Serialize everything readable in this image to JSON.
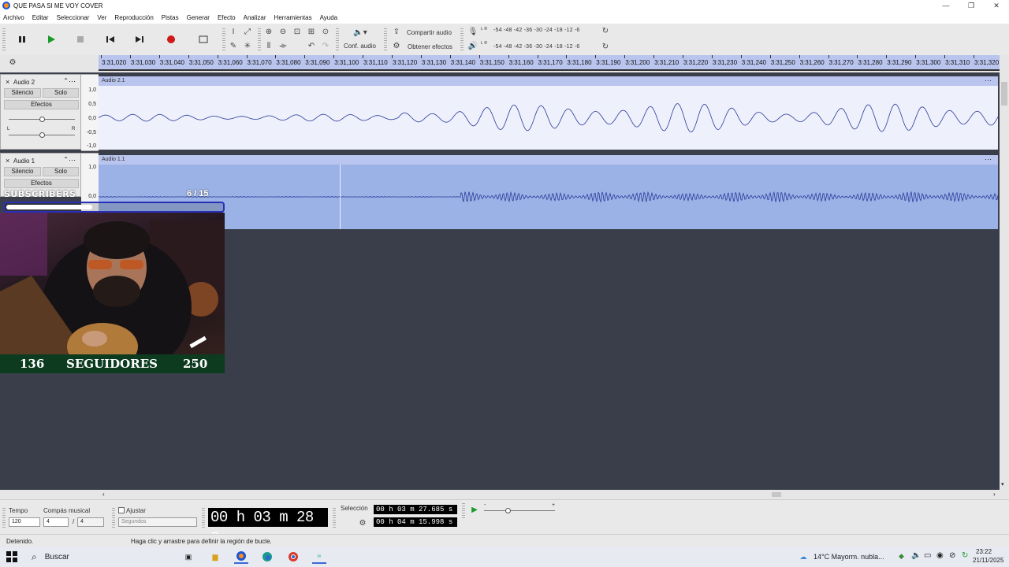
{
  "window": {
    "title": "QUE PASA SI ME VOY COVER",
    "controls": [
      "—",
      "❐",
      "✕"
    ]
  },
  "menu": [
    "Archivo",
    "Editar",
    "Seleccionar",
    "Ver",
    "Reproducción",
    "Pistas",
    "Generar",
    "Efecto",
    "Analizar",
    "Herramientas",
    "Ayuda"
  ],
  "toolbar": {
    "audio_setup_label": "Conf. audio",
    "share_audio_label": "Compartir audio",
    "get_effects_label": "Obtener efectos",
    "meter_record": "-54  -48  -42  -36  -30  -24  -18  -12   -6",
    "meter_play": "-54  -48  -42  -36  -30  -24  -18  -12   -6",
    "meter_record_channels": "L R",
    "meter_play_channels": "L R"
  },
  "ruler_ticks": [
    "3:31,020",
    "3:31,030",
    "3:31,040",
    "3:31,050",
    "3:31,060",
    "3:31,070",
    "3:31,080",
    "3:31,090",
    "3:31,100",
    "3:31,110",
    "3:31,120",
    "3:31,130",
    "3:31,140",
    "3:31,150",
    "3:31,160",
    "3:31,170",
    "3:31,180",
    "3:31,190",
    "3:31,200",
    "3:31,210",
    "3:31,220",
    "3:31,230",
    "3:31,240",
    "3:31,250",
    "3:31,260",
    "3:31,270",
    "3:31,280",
    "3:31,290",
    "3:31,300",
    "3:31,310",
    "3:31,320"
  ],
  "tracks": [
    {
      "name": "Audio 2",
      "clip": "Audio 2.1",
      "mute": "Silencio",
      "solo": "Solo",
      "effects": "Efectos",
      "pan_left": "L",
      "pan_right": "R",
      "scale": [
        "1,0",
        "0,5",
        "0,0",
        "-0,5",
        "-1,0"
      ]
    },
    {
      "name": "Audio 1",
      "clip": "Audio 1.1",
      "mute": "Silencio",
      "solo": "Solo",
      "effects": "Efectos",
      "scale": [
        "1,0",
        "0,0"
      ]
    }
  ],
  "overlay": {
    "subscribers_label": "SUBSCRIBERS",
    "subscribers_count": "6  / 15",
    "subscribers_progress": 0.4,
    "followers_current": "136",
    "followers_label": "SEGUIDORES",
    "followers_goal": "250"
  },
  "bottom": {
    "tempo_label": "Tempo",
    "tempo_value": "120",
    "time_sig_label": "Compás musical",
    "time_sig_num": "4",
    "time_sig_sep": "/",
    "time_sig_den": "4",
    "snap_label": "Ajustar",
    "snap_unit": "Segundos",
    "big_time": "00 h 03 m 28 s",
    "selection_label": "Selección",
    "sel_start": "00 h 03 m 27.685 s",
    "sel_end": "00 h 04 m 15.998 s",
    "speed_min": "-",
    "speed_max": "+"
  },
  "status": {
    "state": "Detenido.",
    "hint": "Haga clic y arrastre para definir la región de bucle."
  },
  "taskbar": {
    "search": "Buscar",
    "weather": "14°C  Mayorm. nubla...",
    "time": "23:22",
    "date": "21/11/2025"
  },
  "colors": {
    "clip_selected": "#9bb2e6",
    "clip_normal": "#eef0fb",
    "ruler": "#b9c5ee",
    "wave": "#2a3a9a",
    "follower_bar": "#0d3b1f"
  }
}
